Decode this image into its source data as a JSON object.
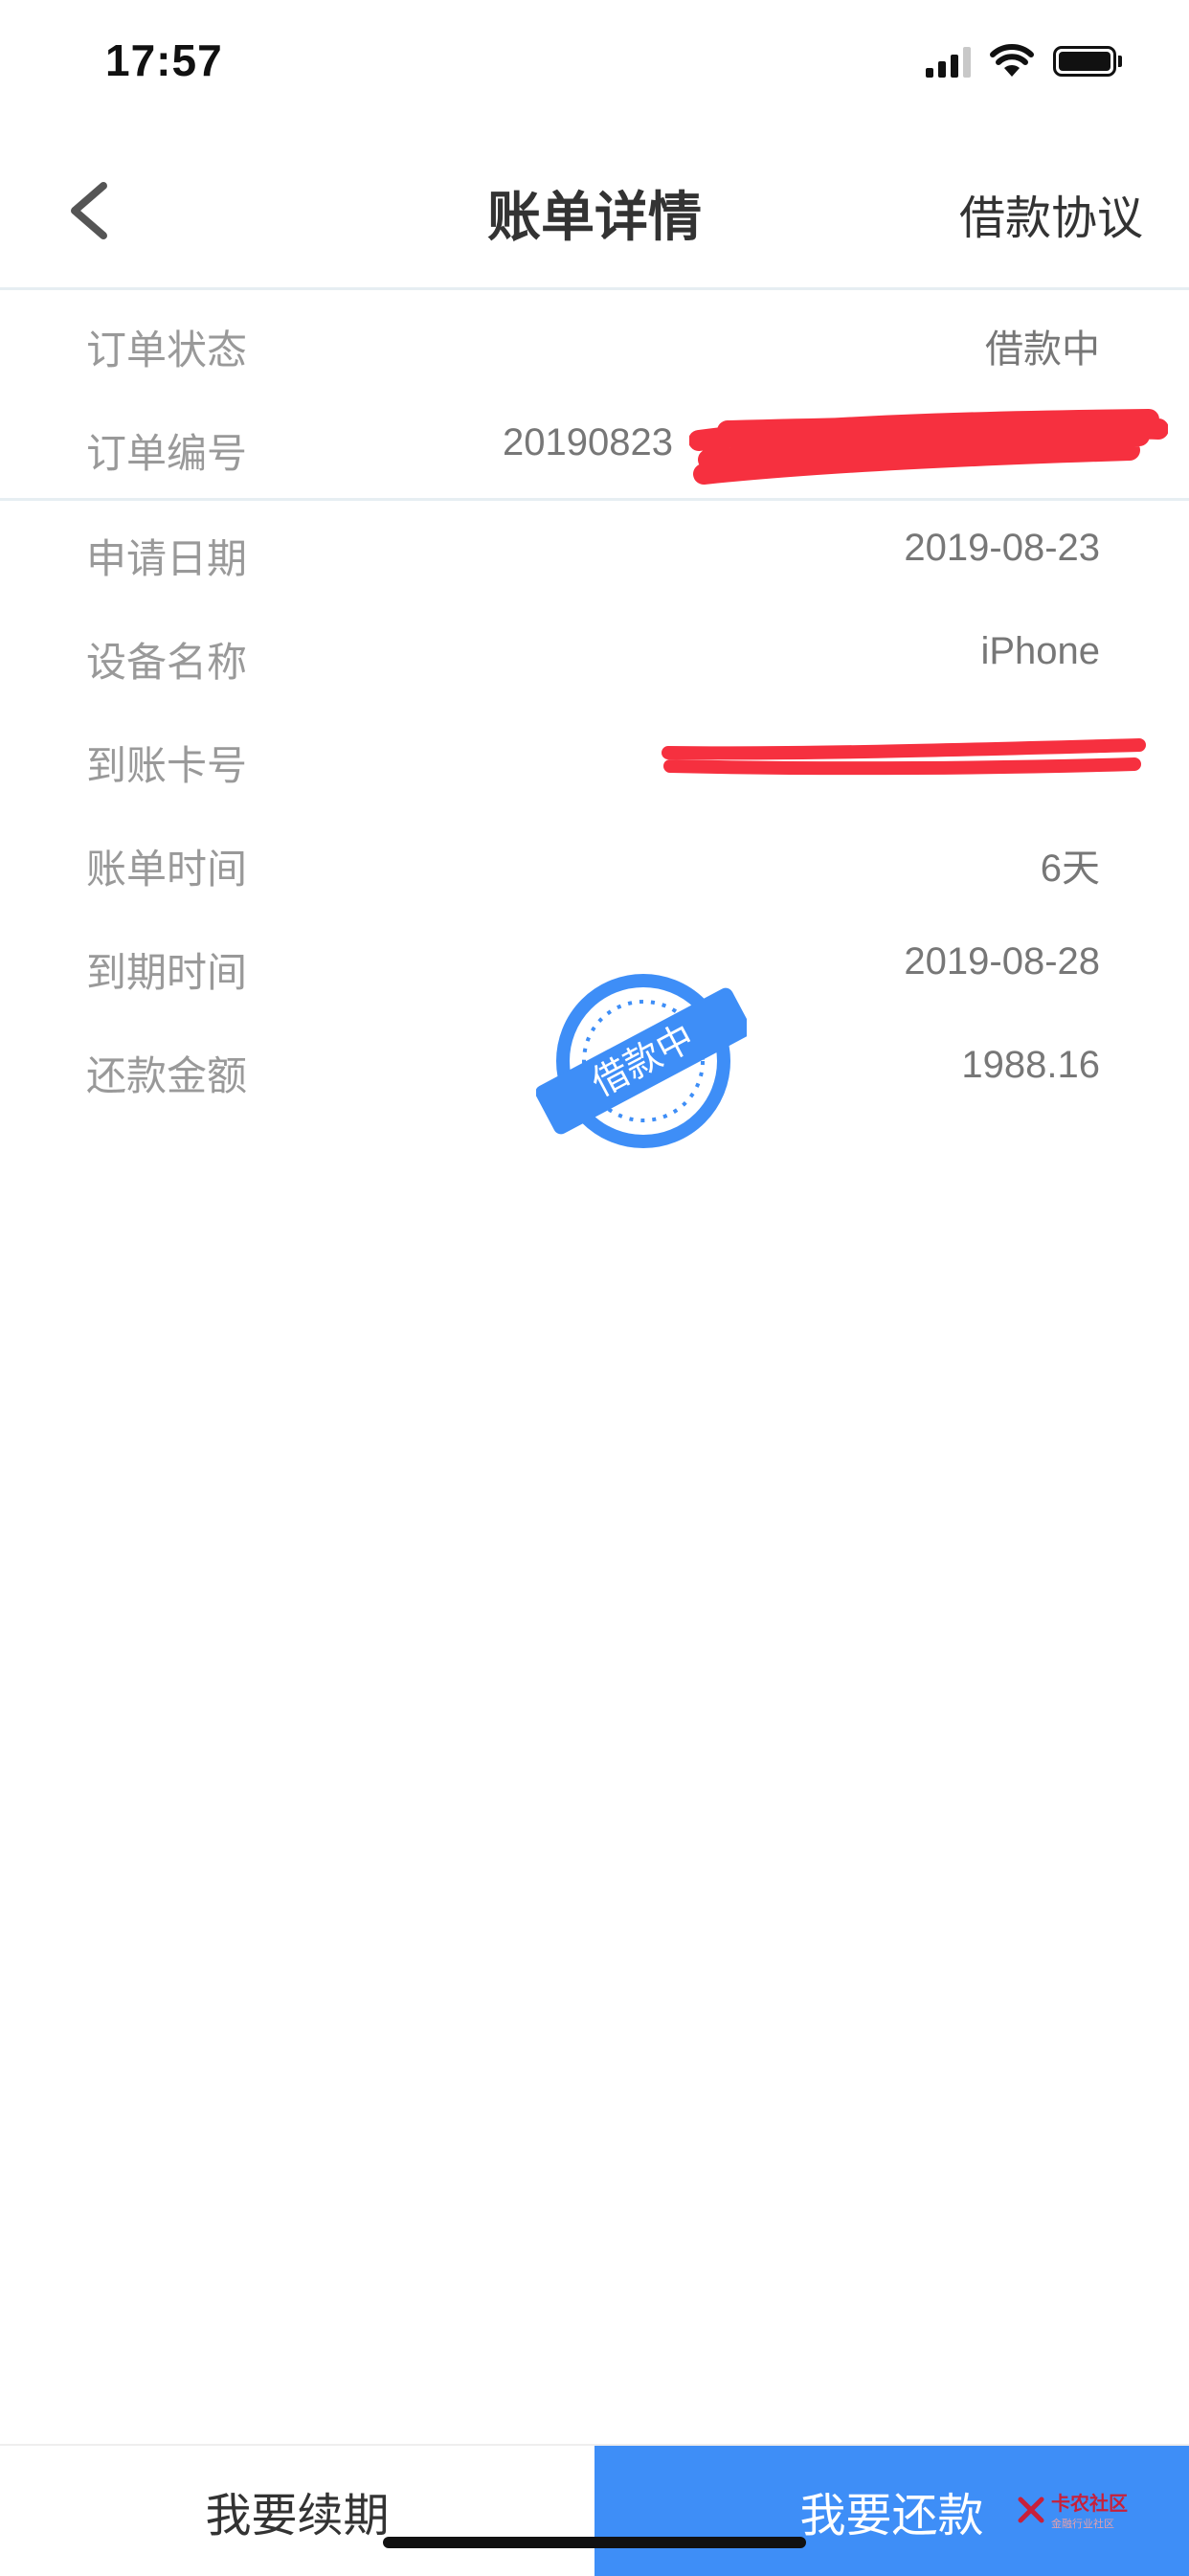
{
  "status_bar": {
    "time": "17:57"
  },
  "nav": {
    "title": "账单详情",
    "right_action": "借款协议"
  },
  "rows": [
    {
      "label": "订单状态",
      "value": "借款中"
    },
    {
      "label": "订单编号",
      "value": "20190823"
    },
    {
      "label": "申请日期",
      "value": "2019-08-23"
    },
    {
      "label": "设备名称",
      "value": "iPhone"
    },
    {
      "label": "到账卡号",
      "value": ""
    },
    {
      "label": "账单时间",
      "value": "6天"
    },
    {
      "label": "到期时间",
      "value": "2019-08-28"
    },
    {
      "label": "还款金额",
      "value": "1988.16"
    }
  ],
  "stamp": {
    "text": "借款中",
    "color": "#3e8ef7"
  },
  "bottom": {
    "renew_label": "我要续期",
    "repay_label": "我要还款"
  },
  "watermark": {
    "text": "卡农社区",
    "subtext": "金融行业社区"
  },
  "colors": {
    "accent": "#3e8ef7",
    "redaction": "#f6303f"
  }
}
